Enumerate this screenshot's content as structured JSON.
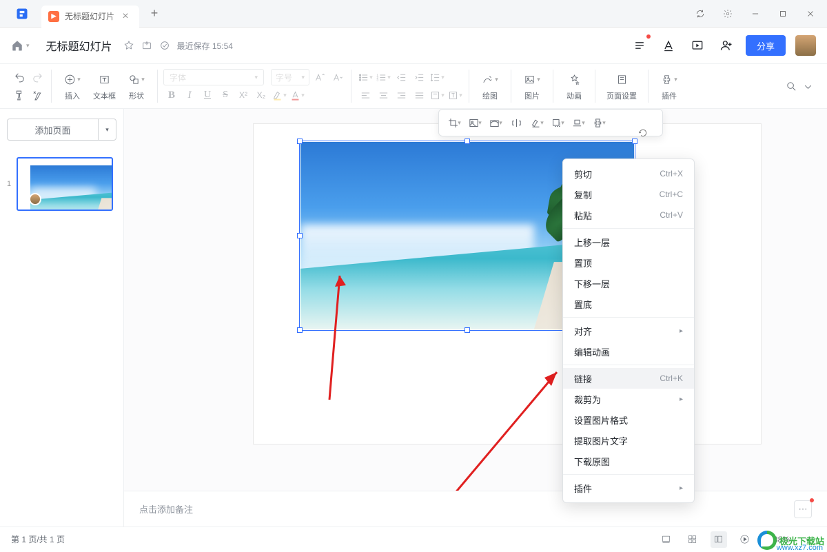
{
  "titlebar": {
    "tab_title": "无标题幻灯片"
  },
  "docbar": {
    "title": "无标题幻灯片",
    "save_status": "最近保存 15:54",
    "share_label": "分享"
  },
  "toolbar": {
    "font_placeholder": "字体",
    "size_placeholder": "字号",
    "insert": "插入",
    "textbox": "文本框",
    "shape": "形状",
    "draw": "绘图",
    "image": "图片",
    "animation": "动画",
    "page_setup": "页面设置",
    "plugin": "插件"
  },
  "sidepanel": {
    "add_page": "添加页面",
    "slide_number": "1"
  },
  "context_menu": {
    "cut": "剪切",
    "cut_sc": "Ctrl+X",
    "copy": "复制",
    "copy_sc": "Ctrl+C",
    "paste": "粘贴",
    "paste_sc": "Ctrl+V",
    "bring_forward": "上移一层",
    "bring_front": "置顶",
    "send_backward": "下移一层",
    "send_back": "置底",
    "align": "对齐",
    "edit_anim": "编辑动画",
    "link": "链接",
    "link_sc": "Ctrl+K",
    "crop_as": "裁剪为",
    "img_format": "设置图片格式",
    "extract_text": "提取图片文字",
    "download_orig": "下载原图",
    "plugins": "插件"
  },
  "notes": {
    "placeholder": "点击添加备注"
  },
  "statusbar": {
    "page_info": "第 1 页/共 1 页",
    "zoom": "88%"
  },
  "watermark": {
    "text": "极光下载站",
    "url": "www.xz7.com"
  }
}
